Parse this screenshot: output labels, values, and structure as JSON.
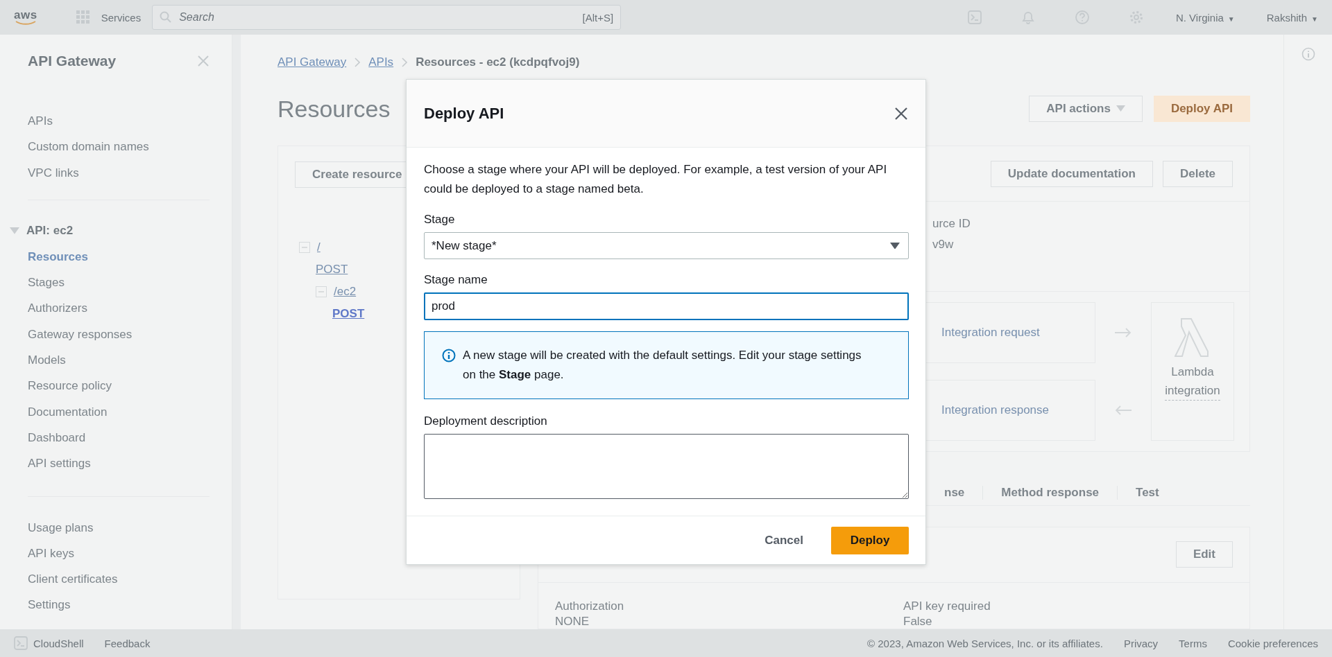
{
  "top_bar": {
    "logo": "aws",
    "services": "Services",
    "search_placeholder": "Search",
    "search_shortcut": "[Alt+S]",
    "region": "N. Virginia",
    "region_caret": "▼",
    "user": "Rakshith",
    "user_caret": "▼"
  },
  "sidebar": {
    "title": "API Gateway",
    "items": [
      {
        "label": "APIs",
        "selected": false
      },
      {
        "label": "Custom domain names",
        "selected": false
      },
      {
        "label": "VPC links",
        "selected": false
      }
    ],
    "api_section": {
      "label": "API: ec2",
      "expanded": true,
      "items": [
        {
          "label": "Resources",
          "selected": true
        },
        {
          "label": "Stages",
          "selected": false
        },
        {
          "label": "Authorizers",
          "selected": false
        },
        {
          "label": "Gateway responses",
          "selected": false
        },
        {
          "label": "Models",
          "selected": false
        },
        {
          "label": "Resource policy",
          "selected": false
        },
        {
          "label": "Documentation",
          "selected": false
        },
        {
          "label": "Dashboard",
          "selected": false
        },
        {
          "label": "API settings",
          "selected": false
        }
      ]
    },
    "bottom_items": [
      {
        "label": "Usage plans",
        "selected": false
      },
      {
        "label": "API keys",
        "selected": false
      },
      {
        "label": "Client certificates",
        "selected": false
      },
      {
        "label": "Settings",
        "selected": false
      }
    ]
  },
  "breadcrumbs": [
    {
      "label": "API Gateway",
      "link": true
    },
    {
      "label": "APIs",
      "link": true
    },
    {
      "label": "Resources - ec2 (kcdpqfvoj9)",
      "link": false
    }
  ],
  "page_title": "Resources",
  "header_buttons": {
    "actions": "API actions",
    "deploy": "Deploy API"
  },
  "resource_panel": {
    "create_button": "Create resource",
    "tree": [
      {
        "label": "/",
        "kind": "resource",
        "expanded": true,
        "selected": false,
        "children": [
          {
            "label": "POST",
            "kind": "method",
            "selected": false
          },
          {
            "label": "/ec2",
            "kind": "resource",
            "expanded": true,
            "selected": false,
            "children": [
              {
                "label": "POST",
                "kind": "method",
                "selected": true
              }
            ]
          }
        ]
      }
    ]
  },
  "detail_panel": {
    "buttons": [
      "Update documentation",
      "Delete"
    ],
    "id_label": "urce ID",
    "id_value": "v9w",
    "integration_request": "Integration request",
    "integration_response": "Integration response",
    "target": "Lambda integration",
    "tabs": [
      {
        "label": "nse",
        "selected": false
      },
      {
        "label": "Method response",
        "selected": false
      },
      {
        "label": "Test",
        "selected": false
      }
    ],
    "edit_button": "Edit",
    "fields": [
      {
        "label": "Authorization",
        "value": "NONE"
      },
      {
        "label": "API key required",
        "value": "False"
      }
    ]
  },
  "modal": {
    "title": "Deploy API",
    "description": "Choose a stage where your API will be deployed. For example, a test version of your API could be deployed to a stage named beta.",
    "stage_label": "Stage",
    "stage_value": "*New stage*",
    "stage_name_label": "Stage name",
    "stage_name_value": "prod",
    "info": "A new stage will be created with the default settings. Edit your stage settings on the **Stage** page.",
    "description_label": "Deployment description",
    "cancel": "Cancel",
    "deploy": "Deploy"
  },
  "footer": {
    "cloudshell": "CloudShell",
    "feedback": "Feedback",
    "copyright": "© 2023, Amazon Web Services, Inc. or its affiliates.",
    "links": [
      "Privacy",
      "Terms",
      "Cookie preferences"
    ]
  }
}
